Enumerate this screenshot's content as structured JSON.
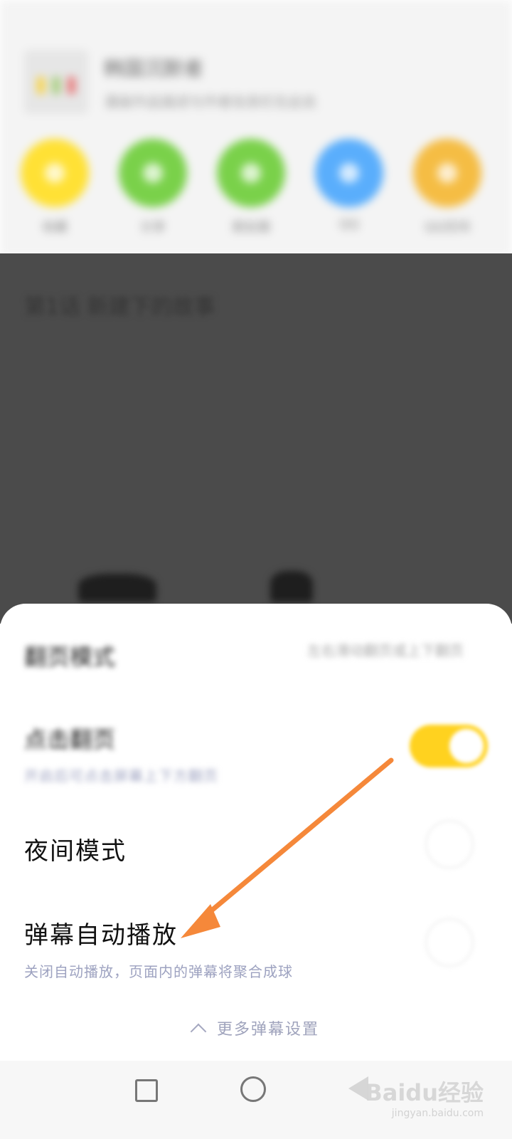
{
  "header": {
    "title": "韩国沉默者",
    "subtitle": "漫画作品描述与作者信息栏在此处"
  },
  "quick_actions": [
    {
      "label": "收藏",
      "color": "#ffe135",
      "icon": "star-icon"
    },
    {
      "label": "分享",
      "color": "#7ad14a",
      "icon": "share-icon"
    },
    {
      "label": "朋友圈",
      "color": "#7ad14a",
      "icon": "moments-icon"
    },
    {
      "label": "QQ",
      "color": "#5aaefc",
      "icon": "qq-icon"
    },
    {
      "label": "QQ空间",
      "color": "#f5bd44",
      "icon": "qzone-icon"
    }
  ],
  "content": {
    "chapter_title": "第1话 新建下的故事"
  },
  "settings": {
    "read_mode": {
      "label": "翻页模式",
      "value": "左右滑动翻页或上下翻页"
    },
    "tap_page": {
      "label": "点击翻页",
      "sub": "开启后可点击屏幕上下方翻页",
      "enabled": true
    },
    "night_mode": {
      "label": "夜间模式",
      "enabled": false
    },
    "danmaku_autoplay": {
      "label": "弹幕自动播放",
      "sub": "关闭自动播放，页面内的弹幕将聚合成球",
      "enabled": false
    }
  },
  "more_settings": {
    "label": "更多弹幕设置"
  },
  "annotation": {
    "arrow_color": "#f5883a"
  },
  "watermark": {
    "brand": "Baidu经验",
    "url": "jingyan.baidu.com"
  }
}
